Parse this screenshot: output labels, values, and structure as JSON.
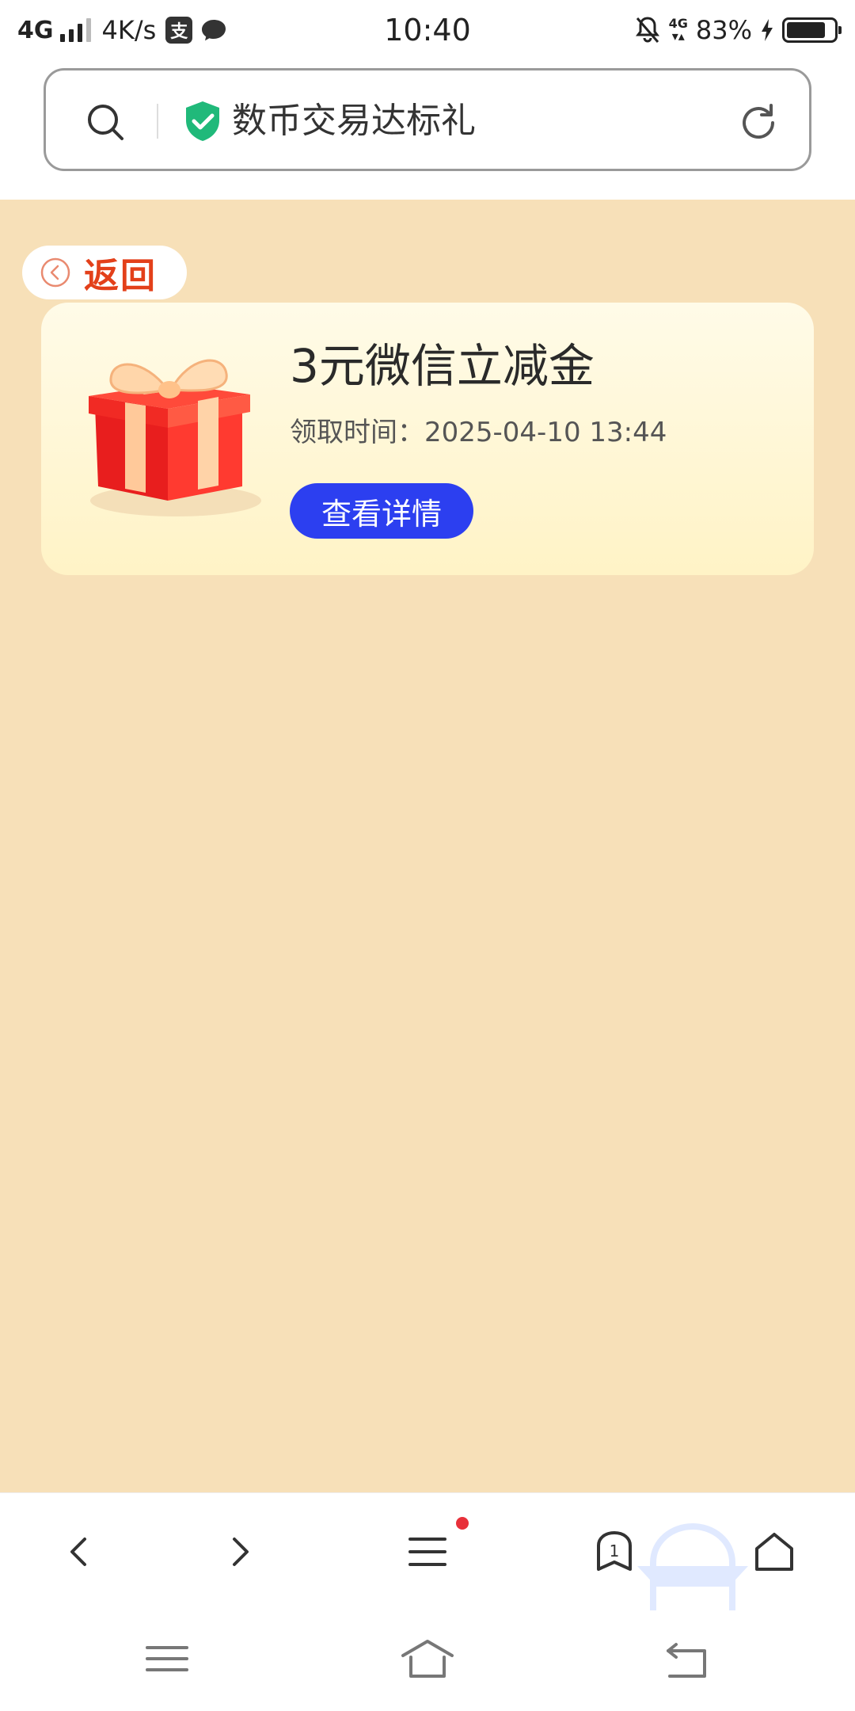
{
  "status_bar": {
    "network": "4G",
    "speed": "4K/s",
    "app_icon_letter": "支",
    "time": "10:40",
    "network_small": "4G",
    "battery_percent": "83%",
    "battery_level": 0.83,
    "signal_bars": 4,
    "signal_bars_filled": 3
  },
  "address_bar": {
    "url_title": "数币交易达标礼",
    "search_icon": "search-icon",
    "secure_icon": "shield-check-icon",
    "reload_icon": "reload-icon",
    "shield_color": "#20b97a"
  },
  "page": {
    "background_color": "#f7e0b8",
    "back_label": "返回",
    "card": {
      "title": "3元微信立减金",
      "time_label": "领取时间：",
      "time_value": "2025-04-10 13:44",
      "detail_button": "查看详情",
      "button_color": "#2c3ff0"
    }
  },
  "browser_bar": {
    "back_icon": "chevron-left-icon",
    "forward_icon": "chevron-right-icon",
    "menu_icon": "menu-icon",
    "tabs_icon": "tabs-icon",
    "tab_count": "1",
    "home_icon": "home-icon"
  },
  "system_nav": {
    "menu_icon": "nav-menu-icon",
    "home_icon": "nav-home-icon",
    "back_icon": "nav-back-icon"
  }
}
